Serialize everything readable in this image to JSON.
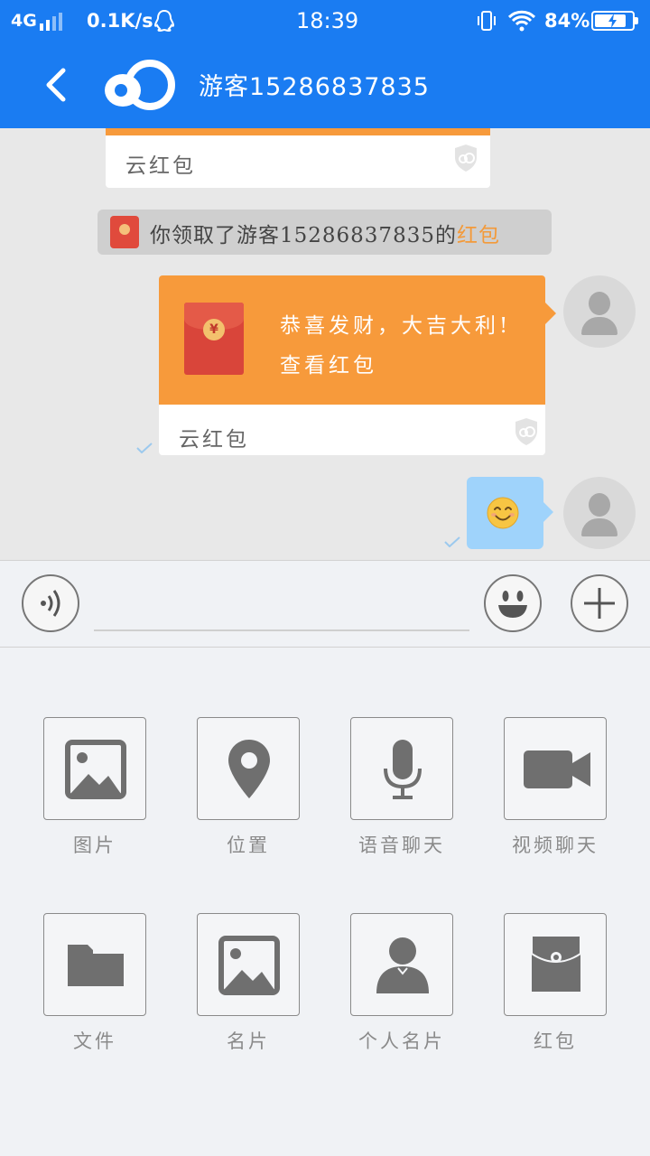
{
  "status_bar": {
    "network": "4G",
    "speed": "0.1K/s",
    "time": "18:39",
    "battery": "84%",
    "battery_level": 0.84
  },
  "header": {
    "title": "游客15286837835",
    "accent_color": "#1a7cf2"
  },
  "chat": {
    "partial_card_label": "云红包",
    "system_message": {
      "prefix": "你领取了游客15286837835的",
      "highlight": "红包",
      "highlight_color": "#f39a3a"
    },
    "red_packet": {
      "greeting": "恭喜发财，大吉大利!",
      "action": "查看红包",
      "footer_label": "云红包",
      "coin_symbol": "¥",
      "color": "#f79a3b"
    },
    "emoji_message": "smiling-face-emoji"
  },
  "input_bar": {
    "placeholder": "",
    "value": ""
  },
  "panel": {
    "tools": [
      {
        "label": "图片",
        "icon": "image-icon"
      },
      {
        "label": "位置",
        "icon": "location-pin-icon"
      },
      {
        "label": "语音聊天",
        "icon": "microphone-icon"
      },
      {
        "label": "视频聊天",
        "icon": "video-camera-icon"
      },
      {
        "label": "文件",
        "icon": "folder-icon"
      },
      {
        "label": "名片",
        "icon": "image-icon"
      },
      {
        "label": "个人名片",
        "icon": "person-icon"
      },
      {
        "label": "红包",
        "icon": "red-packet-icon"
      }
    ]
  }
}
